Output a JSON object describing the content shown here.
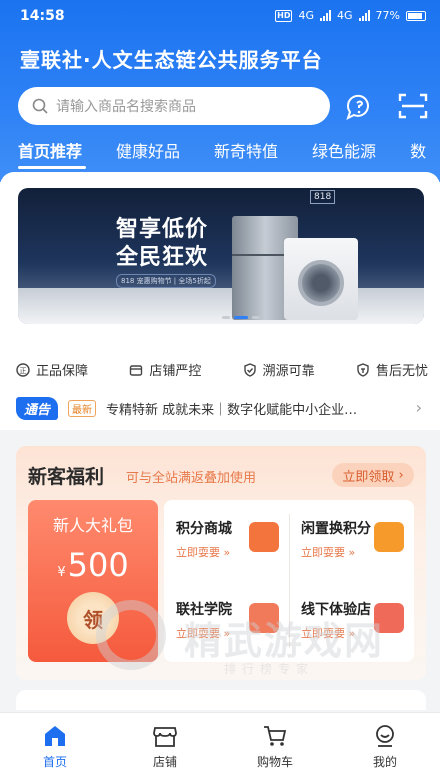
{
  "status_bar": {
    "time": "14:58",
    "hd": "HD",
    "net1": "4G",
    "net2": "4G",
    "battery": "77%"
  },
  "app": {
    "title": "壹联社·人文生态链公共服务平台"
  },
  "search": {
    "placeholder": "请输入商品名搜索商品"
  },
  "header_icons": [
    "customer-service-icon",
    "scan-icon"
  ],
  "tabs": [
    {
      "label": "首页推荐",
      "active": true
    },
    {
      "label": "健康好品"
    },
    {
      "label": "新奇特值"
    },
    {
      "label": "绿色能源"
    },
    {
      "label": "数"
    }
  ],
  "banner": {
    "headline_1": "智享低价",
    "headline_2": "全民狂欢",
    "subline": "818 宠惠购物节 | 全场5折起",
    "badge": "818",
    "slide_index": 1,
    "slide_count": 3
  },
  "guarantees": [
    {
      "label": "正品保障",
      "icon": "verified-icon"
    },
    {
      "label": "店铺严控",
      "icon": "store-icon"
    },
    {
      "label": "溯源可靠",
      "icon": "shield-check-icon"
    },
    {
      "label": "售后无忧",
      "icon": "after-sales-icon"
    }
  ],
  "notice": {
    "tag": "通告",
    "badge": "最新",
    "text": "专精特新 成就未来｜数字化赋能中小企业…"
  },
  "welfare": {
    "title": "新客福利",
    "subtitle": "可与全站满返叠加使用",
    "claim_button": "立即领取",
    "gift": {
      "title": "新人大礼包",
      "currency": "¥",
      "amount": "500",
      "claim": "领"
    },
    "items": [
      {
        "name": "积分商城",
        "action": "立即耍要",
        "icon": "basket-icon",
        "color": "#f4743d"
      },
      {
        "name": "闲置换积分",
        "action": "立即耍要",
        "icon": "backpack-icon",
        "color": "#f79a2c"
      },
      {
        "name": "联社学院",
        "action": "立即耍要",
        "icon": "academy-icon",
        "color": "#f07a5a"
      },
      {
        "name": "线下体验店",
        "action": "立即耍要",
        "icon": "shop-icon",
        "color": "#f06a5a"
      }
    ]
  },
  "watermark": {
    "title": "精武游戏网",
    "subtitle": "排行榜专家"
  },
  "bottom_nav": [
    {
      "label": "首页",
      "icon": "home-icon",
      "active": true
    },
    {
      "label": "店铺",
      "icon": "store-icon"
    },
    {
      "label": "购物车",
      "icon": "cart-icon"
    },
    {
      "label": "我的",
      "icon": "profile-icon"
    }
  ],
  "colors": {
    "primary": "#1e6ff0",
    "accent": "#e8794a",
    "gift": "#f55a3d"
  }
}
